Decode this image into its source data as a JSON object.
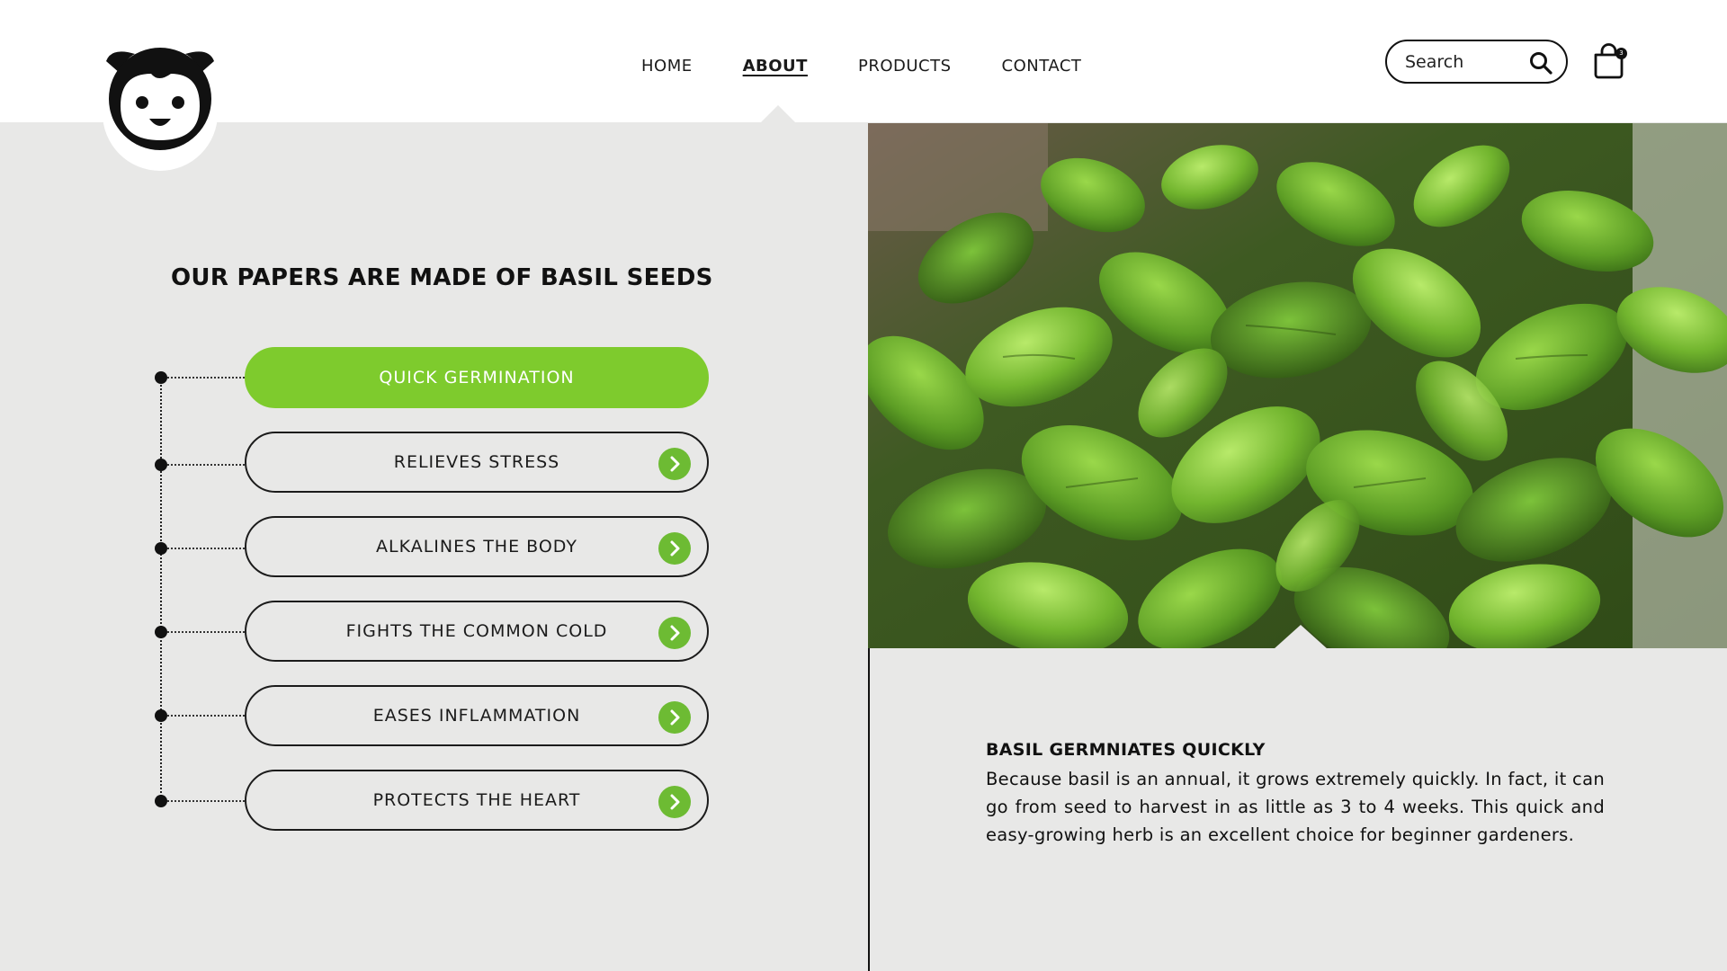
{
  "header": {
    "nav": [
      {
        "label": "HOME",
        "active": false
      },
      {
        "label": "ABOUT",
        "active": true
      },
      {
        "label": "PRODUCTS",
        "active": false
      },
      {
        "label": "CONTACT",
        "active": false
      }
    ],
    "search": {
      "placeholder": "Search"
    },
    "cart": {
      "count": "3"
    }
  },
  "main": {
    "title": "OUR PAPERS ARE MADE OF BASIL SEEDS",
    "features": [
      {
        "label": "QUICK GERMINATION",
        "active": true
      },
      {
        "label": "RELIEVES STRESS",
        "active": false
      },
      {
        "label": "ALKALINES THE BODY",
        "active": false
      },
      {
        "label": "FIGHTS THE COMMON COLD",
        "active": false
      },
      {
        "label": "EASES INFLAMMATION",
        "active": false
      },
      {
        "label": "PROTECTS THE HEART",
        "active": false
      }
    ]
  },
  "info": {
    "title": "BASIL GERMNIATES QUICKLY",
    "body": "Because basil is an annual, it grows extremely quickly. In fact, it can go from seed to harvest in as little as 3 to 4 weeks. This quick and easy-growing herb is an excellent choice for beginner gardeners."
  },
  "colors": {
    "accent": "#7ecb2d",
    "background": "#e8e8e7",
    "text": "#111111"
  },
  "icons": [
    "mascot-logo-icon",
    "search-icon",
    "shopping-bag-icon",
    "chevron-right-icon"
  ]
}
